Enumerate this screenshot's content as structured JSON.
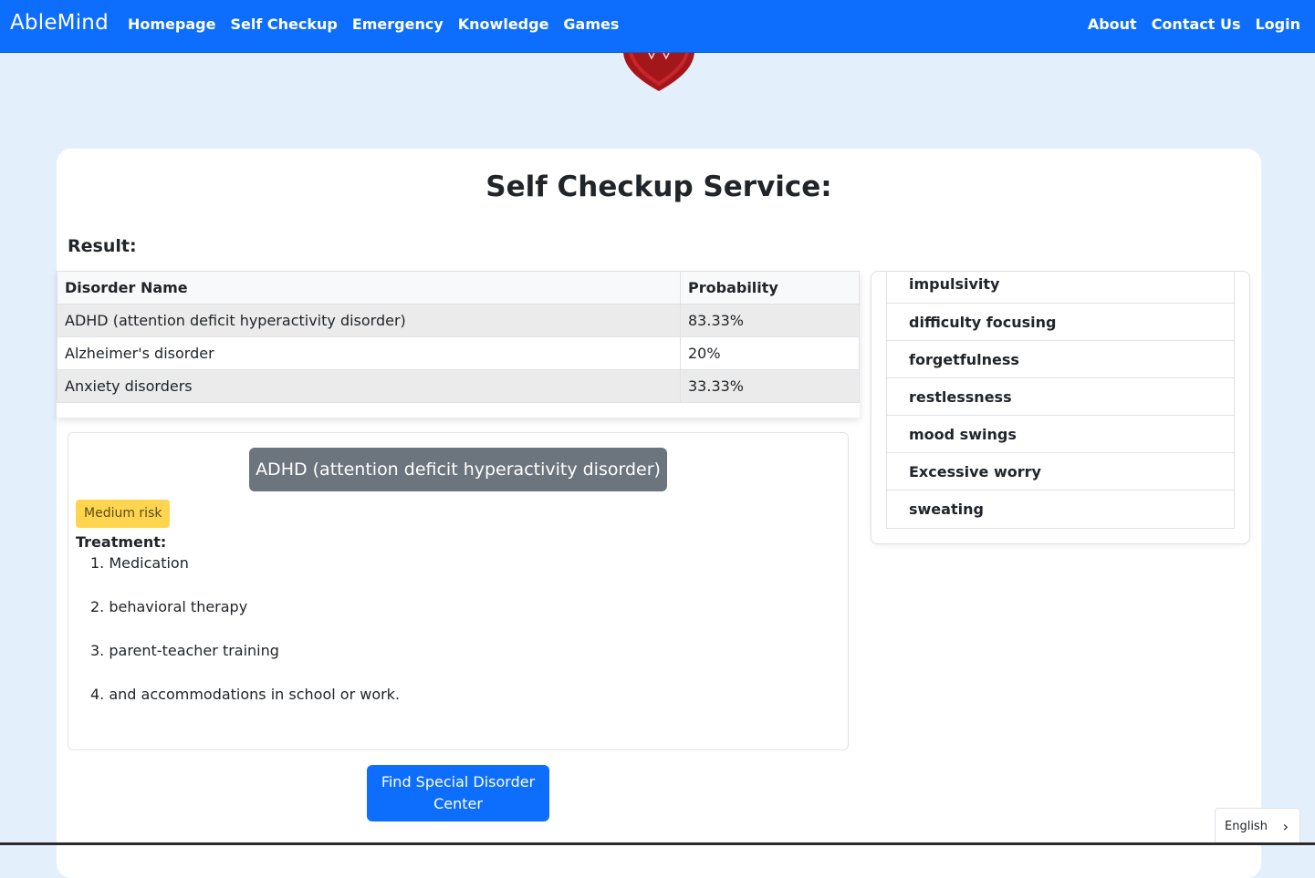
{
  "navbar": {
    "brand": "AbleMind",
    "left_links": [
      "Homepage",
      "Self Checkup",
      "Emergency",
      "Knowledge",
      "Games"
    ],
    "right_links": [
      "About",
      "Contact Us",
      "Login"
    ]
  },
  "page": {
    "title": "Self Checkup Service:",
    "result_label": "Result:"
  },
  "results_table": {
    "headers": [
      "Disorder Name",
      "Probability"
    ],
    "rows": [
      {
        "name": "ADHD (attention deficit hyperactivity disorder)",
        "probability": "83.33%"
      },
      {
        "name": "Alzheimer's disorder",
        "probability": "20%"
      },
      {
        "name": "Anxiety disorders",
        "probability": "33.33%"
      }
    ]
  },
  "detail": {
    "disorder": "ADHD (attention deficit hyperactivity disorder)",
    "risk": "Medium risk",
    "treatment_label": "Treatment:",
    "treatments": [
      "1. Medication",
      "2. behavioral therapy",
      "3. parent-teacher training",
      "4. and accommodations in school or work."
    ],
    "find_button": "Find Special Disorder Center"
  },
  "symptoms": [
    "impulsivity",
    "difficulty focusing",
    "forgetfulness",
    "restlessness",
    "mood swings",
    "Excessive worry",
    "sweating"
  ],
  "language": {
    "selected": "English",
    "chevron_icon": "chevron-right-icon"
  },
  "colors": {
    "primary": "#0d6efd",
    "background": "#e3f0fc",
    "risk_badge": "#ffd54f",
    "pill": "#6c757d"
  }
}
